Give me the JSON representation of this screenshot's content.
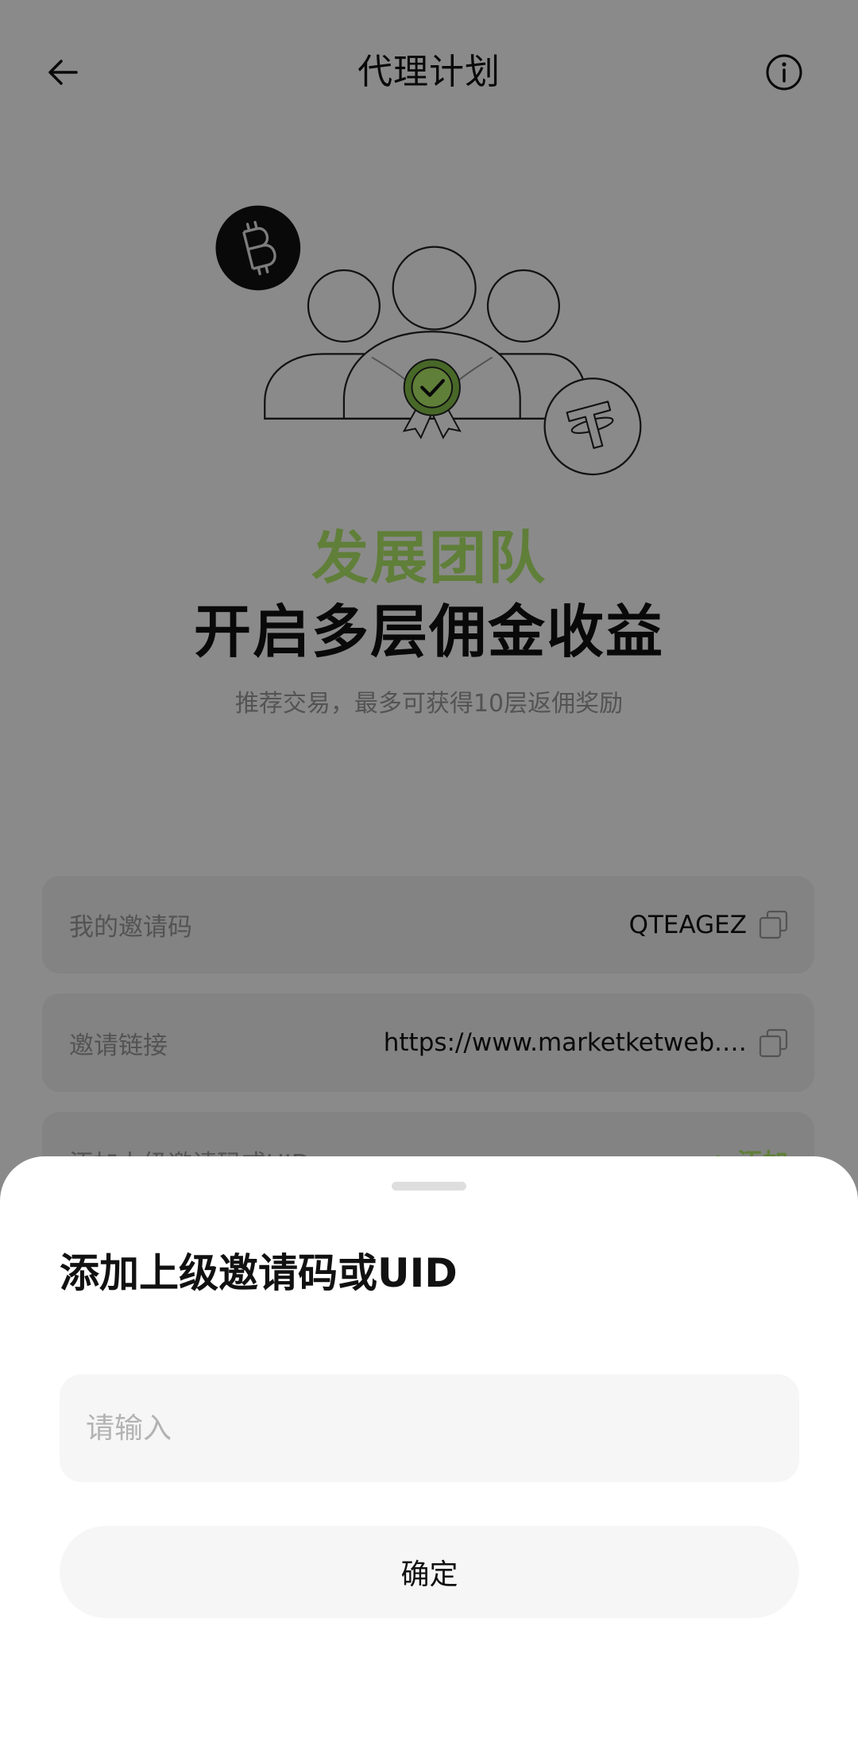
{
  "header": {
    "title": "代理计划",
    "back_icon": "arrow-left-icon",
    "info_icon": "info-icon"
  },
  "hero": {
    "headline_accent": "发展团队",
    "headline": "开启多层佣金收益",
    "subtitle": "推荐交易，最多可获得10层返佣奖励",
    "illustration_icons": [
      "bitcoin-icon",
      "tether-icon",
      "verified-badge-icon",
      "team-members-icon"
    ]
  },
  "referral": {
    "invite_code": {
      "label": "我的邀请码",
      "value": "QTEAGEZ",
      "icon": "copy-icon"
    },
    "invite_link": {
      "label": "邀请链接",
      "value": "https://www.marketketweb.…",
      "icon": "copy-icon"
    },
    "add_referrer": {
      "label": "添加上级邀请码或UID",
      "action": "+ 添加"
    }
  },
  "sheet": {
    "title": "添加上级邀请码或UID",
    "input": {
      "placeholder": "请输入",
      "value": ""
    },
    "confirm_label": "确定"
  },
  "colors": {
    "accent": "#B2EB6A",
    "text": "#111111",
    "muted": "#999999",
    "surface": "#F6F6F6",
    "overlay": "rgba(0,0,0,0.46)"
  }
}
